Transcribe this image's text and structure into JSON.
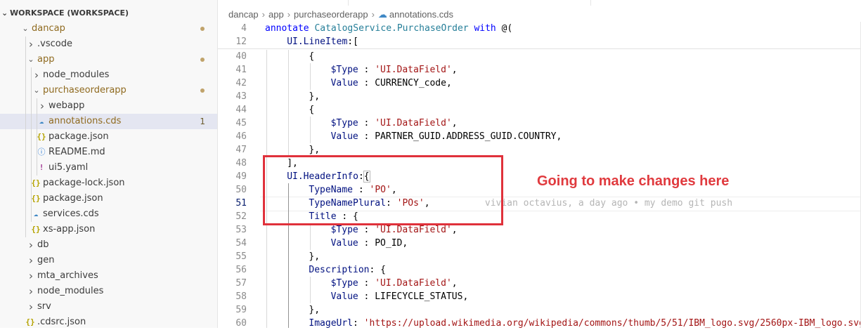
{
  "explorer": {
    "workspace_title": "WORKSPACE (WORKSPACE)",
    "items": [
      {
        "label": "dancap",
        "type": "folder",
        "expanded": true,
        "depth": 0,
        "modified": true
      },
      {
        "label": ".vscode",
        "type": "folder",
        "expanded": false,
        "depth": 1
      },
      {
        "label": "app",
        "type": "folder",
        "expanded": true,
        "depth": 1,
        "modified": true
      },
      {
        "label": "node_modules",
        "type": "folder",
        "expanded": false,
        "depth": 2
      },
      {
        "label": "purchaseorderapp",
        "type": "folder",
        "expanded": true,
        "depth": 2,
        "modified": true
      },
      {
        "label": "webapp",
        "type": "folder",
        "expanded": false,
        "depth": 3
      },
      {
        "label": "annotations.cds",
        "type": "cds",
        "depth": 3,
        "selected": true,
        "problems": "1"
      },
      {
        "label": "package.json",
        "type": "json",
        "depth": 3
      },
      {
        "label": "README.md",
        "type": "info",
        "depth": 3
      },
      {
        "label": "ui5.yaml",
        "type": "yaml",
        "depth": 3
      },
      {
        "label": "package-lock.json",
        "type": "json",
        "depth": 2
      },
      {
        "label": "package.json",
        "type": "json",
        "depth": 2
      },
      {
        "label": "services.cds",
        "type": "cds",
        "depth": 2
      },
      {
        "label": "xs-app.json",
        "type": "json",
        "depth": 2
      },
      {
        "label": "db",
        "type": "folder",
        "expanded": false,
        "depth": 1
      },
      {
        "label": "gen",
        "type": "folder",
        "expanded": false,
        "depth": 1
      },
      {
        "label": "mta_archives",
        "type": "folder",
        "expanded": false,
        "depth": 1
      },
      {
        "label": "node_modules",
        "type": "folder",
        "expanded": false,
        "depth": 1
      },
      {
        "label": "srv",
        "type": "folder",
        "expanded": false,
        "depth": 1
      },
      {
        "label": ".cdsrc.json",
        "type": "json",
        "depth": 1
      }
    ]
  },
  "breadcrumb": [
    "dancap",
    "app",
    "purchaseorderapp",
    "annotations.cds"
  ],
  "editor": {
    "sticky_lines": [
      {
        "n": "4",
        "indent": 0,
        "tokens": [
          [
            "kw",
            "annotate "
          ],
          [
            "ty",
            "CatalogService.PurchaseOrder "
          ],
          [
            "kw",
            "with "
          ],
          [
            "plain",
            "@("
          ]
        ]
      },
      {
        "n": "12",
        "indent": 1,
        "tokens": [
          [
            "prop",
            "UI.LineItem"
          ],
          [
            "plain",
            ":["
          ]
        ]
      }
    ],
    "lines": [
      {
        "n": "40",
        "indent": 2,
        "tokens": [
          [
            "plain",
            "{"
          ]
        ]
      },
      {
        "n": "41",
        "indent": 3,
        "tokens": [
          [
            "prop",
            "$Type"
          ],
          [
            "plain",
            " : "
          ],
          [
            "str",
            "'UI.DataField'"
          ],
          [
            "plain",
            ","
          ]
        ]
      },
      {
        "n": "42",
        "indent": 3,
        "tokens": [
          [
            "prop",
            "Value"
          ],
          [
            "plain",
            " : "
          ],
          [
            "plain",
            "CURRENCY_code,"
          ]
        ]
      },
      {
        "n": "43",
        "indent": 2,
        "tokens": [
          [
            "plain",
            "},"
          ]
        ]
      },
      {
        "n": "44",
        "indent": 2,
        "tokens": [
          [
            "plain",
            "{"
          ]
        ]
      },
      {
        "n": "45",
        "indent": 3,
        "tokens": [
          [
            "prop",
            "$Type"
          ],
          [
            "plain",
            " : "
          ],
          [
            "str",
            "'UI.DataField'"
          ],
          [
            "plain",
            ","
          ]
        ]
      },
      {
        "n": "46",
        "indent": 3,
        "tokens": [
          [
            "prop",
            "Value"
          ],
          [
            "plain",
            " : "
          ],
          [
            "plain",
            "PARTNER_GUID.ADDRESS_GUID.COUNTRY,"
          ]
        ]
      },
      {
        "n": "47",
        "indent": 2,
        "tokens": [
          [
            "plain",
            "},"
          ]
        ]
      },
      {
        "n": "48",
        "indent": 1,
        "tokens": [
          [
            "plain",
            "],"
          ]
        ]
      },
      {
        "n": "49",
        "indent": 1,
        "tokens": [
          [
            "prop",
            "UI.HeaderInfo"
          ],
          [
            "plain",
            ":"
          ],
          [
            "box",
            "{"
          ]
        ]
      },
      {
        "n": "50",
        "indent": 2,
        "tokens": [
          [
            "prop",
            "TypeName"
          ],
          [
            "plain",
            " : "
          ],
          [
            "str",
            "'PO'"
          ],
          [
            "plain",
            ","
          ]
        ]
      },
      {
        "n": "51",
        "indent": 2,
        "current": true,
        "tokens": [
          [
            "prop",
            "TypeNamePlural"
          ],
          [
            "plain",
            ": "
          ],
          [
            "str",
            "'POs'"
          ],
          [
            "plain",
            ",     "
          ],
          [
            "blame",
            "     vivian octavius, a day ago • my demo git push"
          ]
        ]
      },
      {
        "n": "52",
        "indent": 2,
        "tokens": [
          [
            "prop",
            "Title"
          ],
          [
            "plain",
            " : {"
          ]
        ]
      },
      {
        "n": "53",
        "indent": 3,
        "tokens": [
          [
            "prop",
            "$Type"
          ],
          [
            "plain",
            " : "
          ],
          [
            "str",
            "'UI.DataField'"
          ],
          [
            "plain",
            ","
          ]
        ]
      },
      {
        "n": "54",
        "indent": 3,
        "tokens": [
          [
            "prop",
            "Value"
          ],
          [
            "plain",
            " : "
          ],
          [
            "plain",
            "PO_ID,"
          ]
        ]
      },
      {
        "n": "55",
        "indent": 2,
        "tokens": [
          [
            "plain",
            "},"
          ]
        ]
      },
      {
        "n": "56",
        "indent": 2,
        "tokens": [
          [
            "prop",
            "Description"
          ],
          [
            "plain",
            ": {"
          ]
        ]
      },
      {
        "n": "57",
        "indent": 3,
        "tokens": [
          [
            "prop",
            "$Type"
          ],
          [
            "plain",
            " : "
          ],
          [
            "str",
            "'UI.DataField'"
          ],
          [
            "plain",
            ","
          ]
        ]
      },
      {
        "n": "58",
        "indent": 3,
        "tokens": [
          [
            "prop",
            "Value"
          ],
          [
            "plain",
            " : "
          ],
          [
            "plain",
            "LIFECYCLE_STATUS,"
          ]
        ]
      },
      {
        "n": "59",
        "indent": 2,
        "tokens": [
          [
            "plain",
            "},"
          ]
        ]
      },
      {
        "n": "60",
        "indent": 2,
        "tokens": [
          [
            "prop",
            "ImageUrl"
          ],
          [
            "plain",
            ": "
          ],
          [
            "str",
            "'https://upload.wikimedia.org/wikipedia/commons/thumb/5/51/IBM_logo.svg/2560px-IBM_logo.svg."
          ]
        ]
      }
    ]
  },
  "annotation": {
    "text": "Going to make changes here",
    "color": "#e03a3e"
  }
}
